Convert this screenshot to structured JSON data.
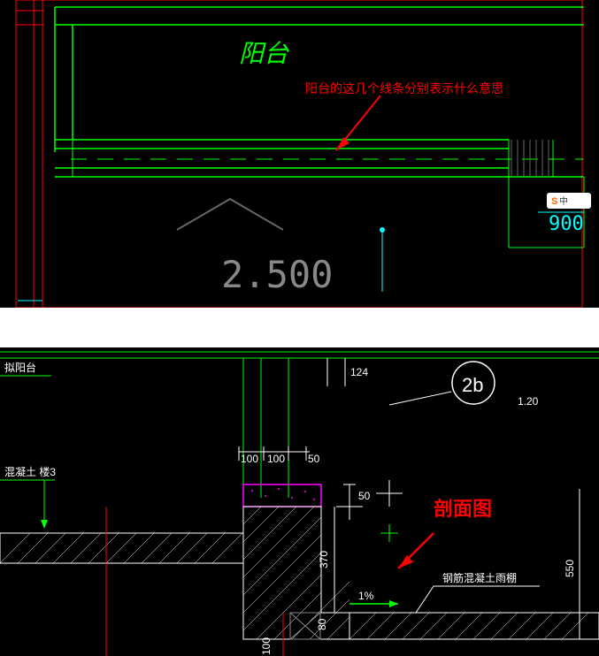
{
  "view1": {
    "room_label": "阳台",
    "annotation_text": "阳台的这几个线条分别表示什么意思",
    "dimension_horizontal": "2.500",
    "dimension_right": "900"
  },
  "view2": {
    "top_left_label": "拟阳台",
    "material_label": "混凝土  楼3",
    "callout_number": "2b",
    "callout_scale": "1.20",
    "dim_124": "124",
    "dim_100a": "100",
    "dim_100b": "100",
    "dim_50": "50",
    "dim_50b": "50",
    "dim_370": "370",
    "dim_80": "80",
    "dim_100c": "100",
    "dim_550": "550",
    "slope": "1%",
    "section_label": "剖面图",
    "rain_shed_label": "钢筋混凝土雨棚"
  },
  "icons": {
    "arrow": "arrow",
    "triangle": "triangle"
  }
}
